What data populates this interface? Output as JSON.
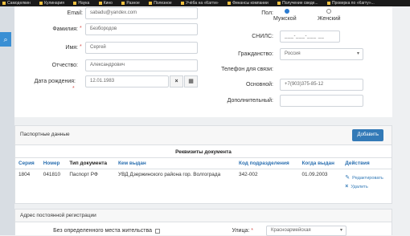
{
  "bookmarks": [
    "Самоделкин",
    "Кулинария",
    "Наука",
    "Кино",
    "Разное",
    "Полезное",
    "Учёба на «Кагти»",
    "Финансы компании",
    "Получение сведе...",
    "Проверка по «Кагту»..."
  ],
  "form": {
    "email_label": "Email:",
    "email_value": "sabadu@yandex.com",
    "lastname_label": "Фамилия:",
    "lastname_value": "Безбородов",
    "firstname_label": "Имя:",
    "firstname_value": "Сергей",
    "patronymic_label": "Отчество:",
    "patronymic_value": "Александрович",
    "birthdate_label": "Дата рождения:",
    "birthdate_value": "12.01.1983",
    "required_mark": "*",
    "sex_label": "Пол:",
    "sex_male": "Мужской",
    "sex_female": "Женский",
    "snils_label": "СНИЛС:",
    "snils_placeholder": "___-___-___ __",
    "citizenship_label": "Гражданство:",
    "citizenship_value": "Россия",
    "phones_label": "Телефон для связи:",
    "main_phone_label": "Основной:",
    "main_phone_value": "+7(903)375-85-12",
    "extra_phone_label": "Дополнительный:",
    "extra_phone_value": ""
  },
  "passport": {
    "title": "Паспортные данные",
    "add_label": "Добавить",
    "group_header": "Реквизиты документа",
    "columns": [
      "Серия",
      "Номер",
      "Тип документа",
      "Кем выдан",
      "Код подразделения",
      "Когда выдан",
      "Действия"
    ],
    "rows": [
      {
        "series": "1804",
        "number": "041810",
        "type": "Паспорт РФ",
        "issuer": "УВД Дзержинского района гор. Волгограда",
        "code": "342-002",
        "date": "01.09.2003"
      }
    ],
    "edit_label": "Редактировать",
    "delete_label": "Удалить"
  },
  "address": {
    "title": "Адрес постоянной регистрации",
    "no_residence_label": "Без определенного места жительства",
    "street_label": "Улица:",
    "street_value": "Красноармейская"
  },
  "icons": {
    "clear": "×",
    "calendar": "▦",
    "caret": "▾",
    "search": "⌕"
  }
}
